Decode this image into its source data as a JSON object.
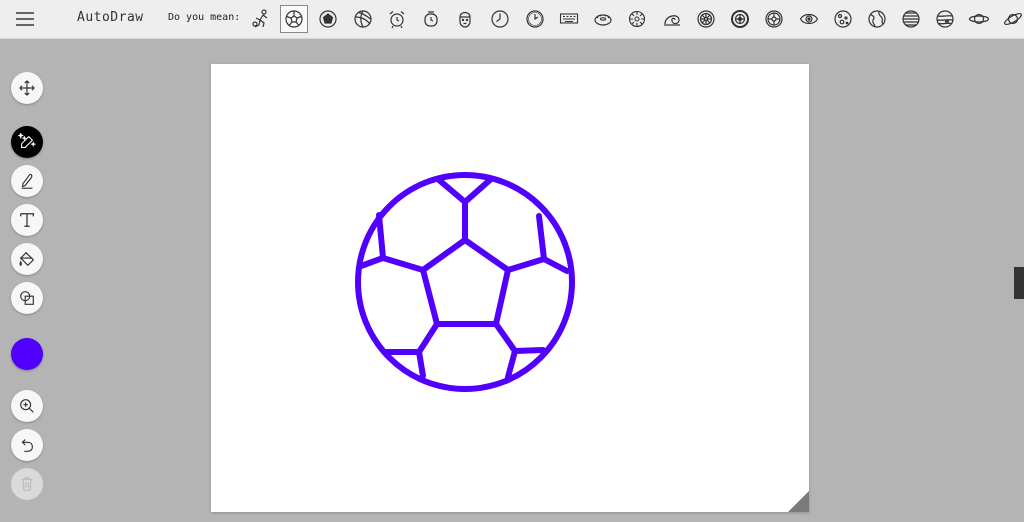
{
  "app": {
    "title": "AutoDraw",
    "prompt": "Do you mean:"
  },
  "colors": {
    "accent": "#5100ff",
    "topbar": "#eeeeee",
    "workspace": "#b4b4b4"
  },
  "suggestions": [
    {
      "icon": "soccer-player-icon"
    },
    {
      "icon": "soccer-ball-icon",
      "selected": true
    },
    {
      "icon": "soccer-ball-alt-icon"
    },
    {
      "icon": "volleyball-icon"
    },
    {
      "icon": "alarm-clock-icon"
    },
    {
      "icon": "alarm-clock-alt-icon"
    },
    {
      "icon": "face-icon"
    },
    {
      "icon": "wall-clock-icon"
    },
    {
      "icon": "clock-icon"
    },
    {
      "icon": "keyboard-icon"
    },
    {
      "icon": "donut-icon"
    },
    {
      "icon": "sand-dollar-icon"
    },
    {
      "icon": "snail-shell-icon"
    },
    {
      "icon": "wheel-icon"
    },
    {
      "icon": "tire-icon"
    },
    {
      "icon": "wheel-rim-icon"
    },
    {
      "icon": "eye-icon"
    },
    {
      "icon": "moon-icon"
    },
    {
      "icon": "earth-globe-icon"
    },
    {
      "icon": "striped-planet-icon"
    },
    {
      "icon": "jupiter-icon"
    },
    {
      "icon": "ringed-planet-icon"
    },
    {
      "icon": "saturn-icon"
    }
  ],
  "tools": [
    {
      "name": "move-tool",
      "icon": "move-arrows-icon"
    },
    {
      "name": "autodraw-tool",
      "icon": "magic-pen-icon",
      "active": true
    },
    {
      "name": "draw-tool",
      "icon": "pen-icon"
    },
    {
      "name": "type-tool",
      "icon": "text-icon"
    },
    {
      "name": "fill-tool",
      "icon": "paint-bucket-icon"
    },
    {
      "name": "shape-tool",
      "icon": "shapes-icon"
    },
    {
      "name": "zoom-tool",
      "icon": "zoom-in-icon"
    },
    {
      "name": "undo-tool",
      "icon": "undo-icon"
    },
    {
      "name": "delete-tool",
      "icon": "trash-icon",
      "disabled": true
    }
  ],
  "drawing": {
    "subject": "soccer ball",
    "stroke_color": "#5100ff"
  }
}
